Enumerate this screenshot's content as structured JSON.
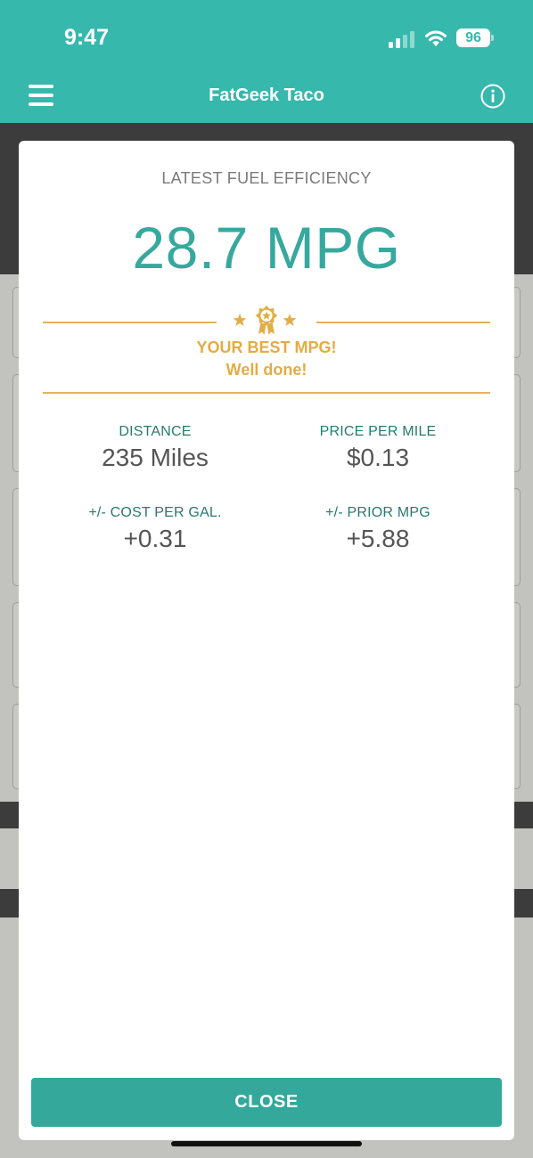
{
  "status_bar": {
    "time": "9:47",
    "battery": "96"
  },
  "header": {
    "title": "FatGeek Taco",
    "color": "#37b8ac"
  },
  "modal": {
    "heading": "LATEST FUEL EFFICIENCY",
    "mpg": "28.7 MPG",
    "best_title": "YOUR BEST MPG!",
    "best_subtitle": "Well done!",
    "stats": [
      {
        "label": "DISTANCE",
        "value": "235 Miles"
      },
      {
        "label": "PRICE PER MILE",
        "value": "$0.13"
      },
      {
        "label": "+/- COST PER GAL.",
        "value": "+0.31"
      },
      {
        "label": "+/- PRIOR MPG",
        "value": "+5.88"
      }
    ],
    "close_label": "CLOSE",
    "accent_color": "#37a89d",
    "award_color": "#e3ac45"
  }
}
